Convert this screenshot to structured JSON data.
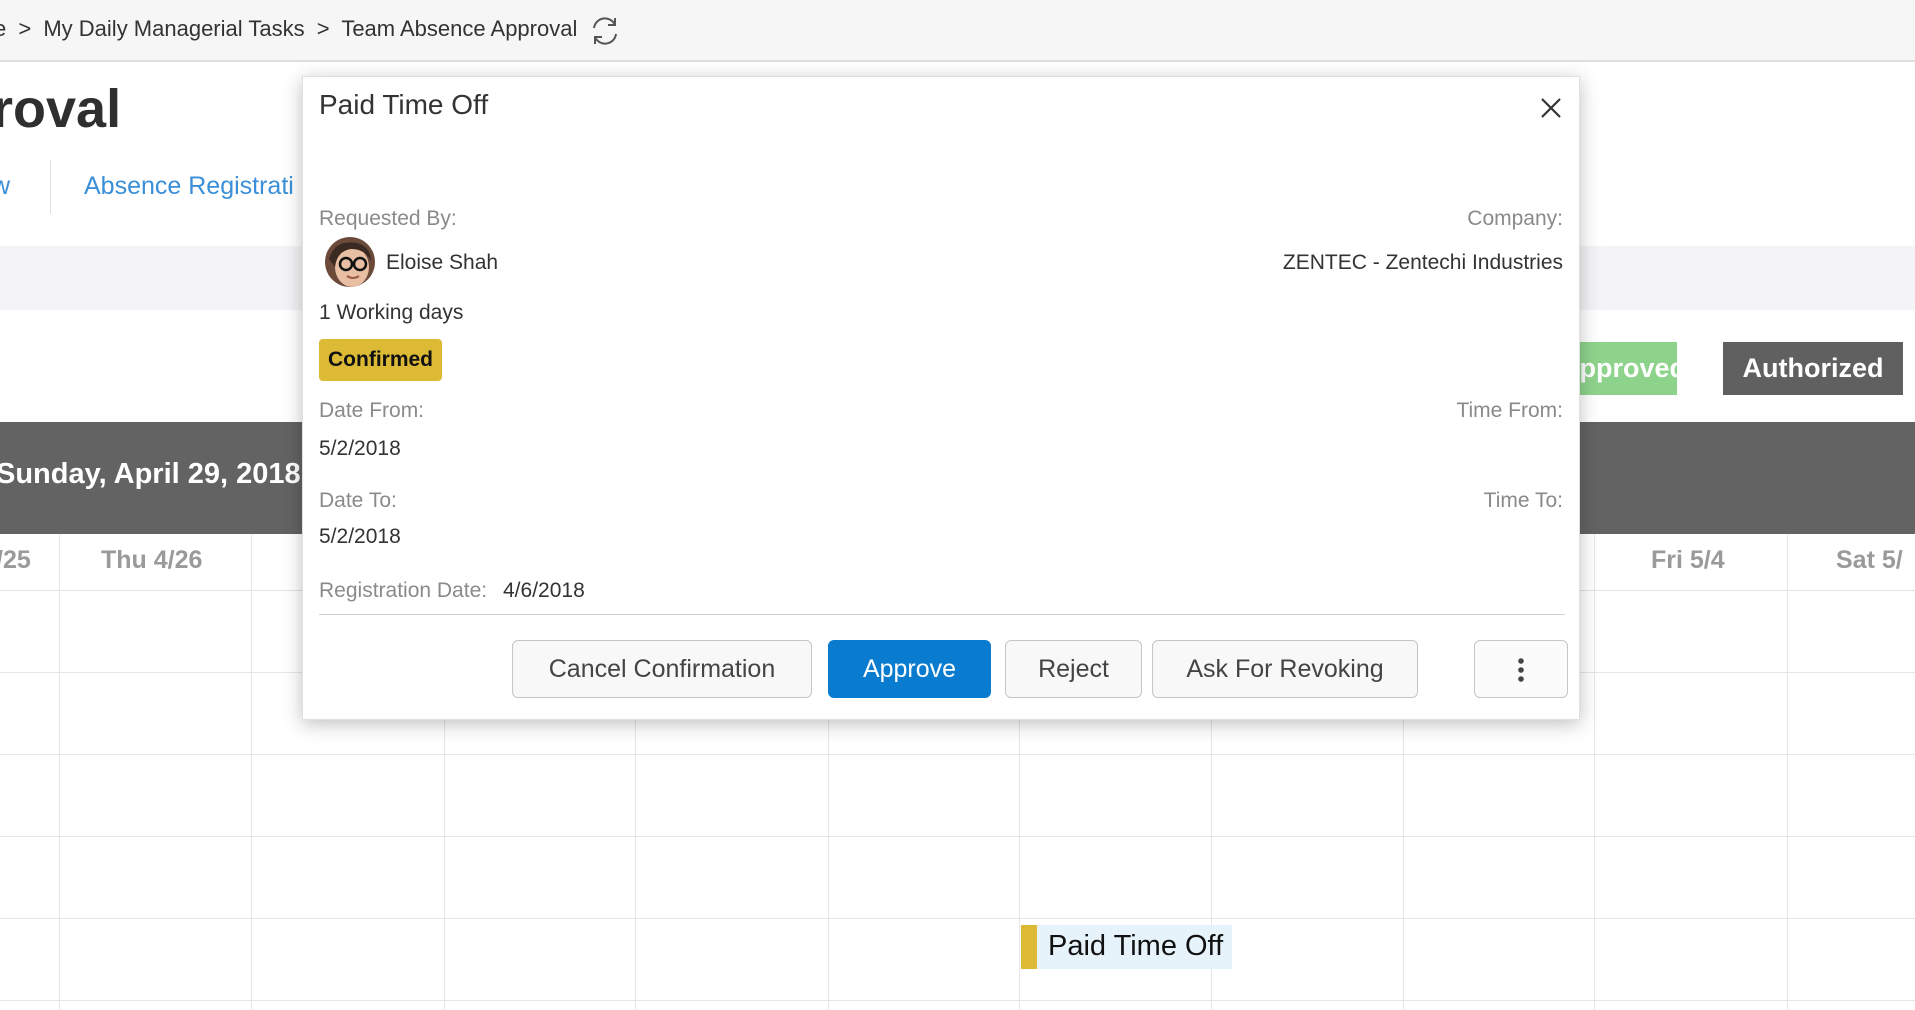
{
  "breadcrumb": {
    "items": [
      "e",
      "My Daily Managerial Tasks",
      "Team Absence Approval"
    ],
    "separator": ">"
  },
  "page": {
    "title": "roval",
    "tabs": [
      {
        "label": "w"
      },
      {
        "label": "Absence Registrati"
      }
    ]
  },
  "legend": {
    "approved": "Approved",
    "authorized": "Authorized"
  },
  "calendar": {
    "header_date": "Sunday, April 29, 2018",
    "days": [
      "/25",
      "Thu 4/26",
      "Fri 5/4",
      "Sat 5/"
    ],
    "event_label": "Paid Time Off"
  },
  "dialog": {
    "title": "Paid Time Off",
    "requested_by_label": "Requested By:",
    "requester_name": "Eloise Shah",
    "company_label": "Company:",
    "company_value": "ZENTEC - Zentechi Industries",
    "working_days": "1 Working days",
    "status": "Confirmed",
    "date_from_label": "Date From:",
    "date_from_value": "5/2/2018",
    "time_from_label": "Time From:",
    "date_to_label": "Date To:",
    "date_to_value": "5/2/2018",
    "time_to_label": "Time To:",
    "registration_date_label": "Registration Date:",
    "registration_date_value": "4/6/2018",
    "buttons": {
      "cancel_confirmation": "Cancel Confirmation",
      "approve": "Approve",
      "reject": "Reject",
      "ask_for_revoking": "Ask For Revoking"
    }
  },
  "icons": {
    "refresh": "refresh-icon",
    "close": "close-icon",
    "more": "more-vertical-icon"
  },
  "colors": {
    "accent_blue": "#0a7ccf",
    "link_blue": "#3a8fd8",
    "status_yellow": "#dcba35",
    "approved_green": "#8ed38c",
    "authorized_grey": "#606060",
    "calendar_header": "#636363"
  }
}
